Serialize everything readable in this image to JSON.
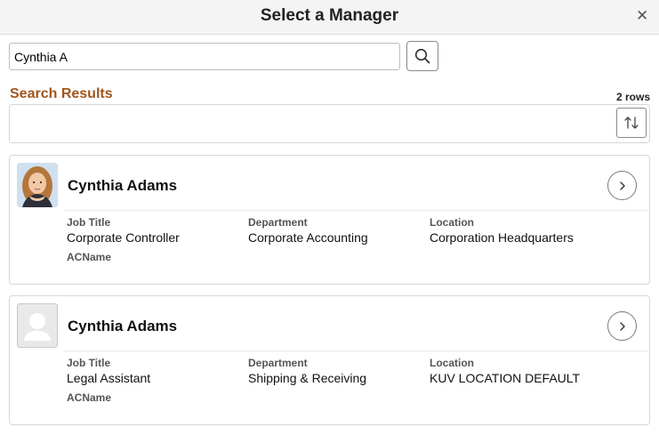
{
  "header": {
    "title": "Select a Manager",
    "close_icon": "close-icon"
  },
  "search": {
    "value": "Cynthia A",
    "button_icon": "search-icon"
  },
  "results": {
    "title": "Search Results",
    "count": "2 rows",
    "sort_icon": "sort-icon"
  },
  "labels": {
    "job_title": "Job Title",
    "department": "Department",
    "location": "Location",
    "acname": "ACName"
  },
  "cards": [
    {
      "name": "Cynthia Adams",
      "job_title": "Corporate Controller",
      "department": "Corporate Accounting",
      "location": "Corporation Headquarters",
      "photo": "person-photo"
    },
    {
      "name": "Cynthia Adams",
      "job_title": "Legal Assistant",
      "department": "Shipping & Receiving",
      "location": "KUV LOCATION DEFAULT",
      "photo": "avatar-placeholder-icon"
    }
  ],
  "colors": {
    "results_title": "#a0561e",
    "header_bg": "#f4f4f4"
  }
}
